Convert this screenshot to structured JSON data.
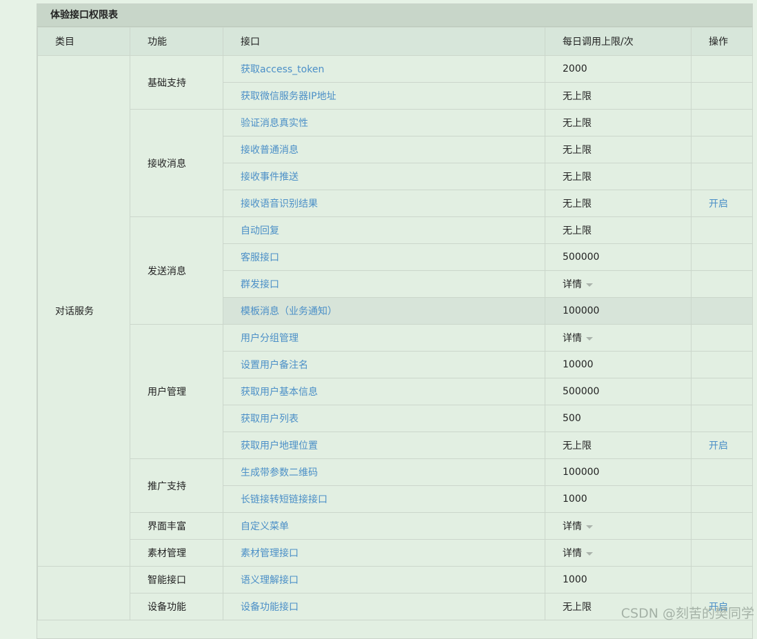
{
  "panel": {
    "title": "体验接口权限表"
  },
  "headers": {
    "category": "类目",
    "function": "功能",
    "api": "接口",
    "limit": "每日调用上限/次",
    "action": "操作"
  },
  "categories": [
    {
      "label": "对话服务"
    }
  ],
  "functions": {
    "basic": "基础支持",
    "receive": "接收消息",
    "send": "发送消息",
    "user": "用户管理",
    "promote": "推广支持",
    "ui": "界面丰富",
    "material": "素材管理",
    "smart": "智能接口",
    "device": "设备功能"
  },
  "rows": [
    {
      "api": "获取access_token",
      "limit": "2000",
      "action": ""
    },
    {
      "api": "获取微信服务器IP地址",
      "limit": "无上限",
      "action": ""
    },
    {
      "api": "验证消息真实性",
      "limit": "无上限",
      "action": ""
    },
    {
      "api": "接收普通消息",
      "limit": "无上限",
      "action": ""
    },
    {
      "api": "接收事件推送",
      "limit": "无上限",
      "action": ""
    },
    {
      "api": "接收语音识别结果",
      "limit": "无上限",
      "action": "开启"
    },
    {
      "api": "自动回复",
      "limit": "无上限",
      "action": ""
    },
    {
      "api": "客服接口",
      "limit": "500000",
      "action": ""
    },
    {
      "api": "群发接口",
      "limit": "详情",
      "action": ""
    },
    {
      "api": "模板消息（业务通知）",
      "limit": "100000",
      "action": ""
    },
    {
      "api": "用户分组管理",
      "limit": "详情",
      "action": ""
    },
    {
      "api": "设置用户备注名",
      "limit": "10000",
      "action": ""
    },
    {
      "api": "获取用户基本信息",
      "limit": "500000",
      "action": ""
    },
    {
      "api": "获取用户列表",
      "limit": "500",
      "action": ""
    },
    {
      "api": "获取用户地理位置",
      "limit": "无上限",
      "action": "开启"
    },
    {
      "api": "生成带参数二维码",
      "limit": "100000",
      "action": ""
    },
    {
      "api": "长链接转短链接接口",
      "limit": "1000",
      "action": ""
    },
    {
      "api": "自定义菜单",
      "limit": "详情",
      "action": ""
    },
    {
      "api": "素材管理接口",
      "limit": "详情",
      "action": ""
    },
    {
      "api": "语义理解接口",
      "limit": "1000",
      "action": ""
    },
    {
      "api": "设备功能接口",
      "limit": "无上限",
      "action": "开启"
    }
  ],
  "watermark": "CSDN @刻苦的樊同学"
}
